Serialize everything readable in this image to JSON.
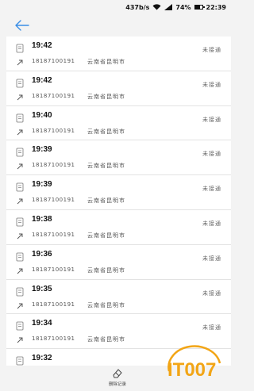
{
  "status_bar": {
    "speed": "437b/s",
    "battery_text": "74%",
    "battery_level": 0.74,
    "time": "22:39"
  },
  "header": {
    "back_icon": "back-arrow-icon"
  },
  "records": [
    {
      "time": "19:42",
      "phone": "18187100191",
      "location": "云南省昆明市",
      "status": "未接通"
    },
    {
      "time": "19:42",
      "phone": "18187100191",
      "location": "云南省昆明市",
      "status": "未接通"
    },
    {
      "time": "19:40",
      "phone": "18187100191",
      "location": "云南省昆明市",
      "status": "未接通"
    },
    {
      "time": "19:39",
      "phone": "18187100191",
      "location": "云南省昆明市",
      "status": "未接通"
    },
    {
      "time": "19:39",
      "phone": "18187100191",
      "location": "云南省昆明市",
      "status": "未接通"
    },
    {
      "time": "19:38",
      "phone": "18187100191",
      "location": "云南省昆明市",
      "status": "未接通"
    },
    {
      "time": "19:36",
      "phone": "18187100191",
      "location": "云南省昆明市",
      "status": "未接通"
    },
    {
      "time": "19:35",
      "phone": "18187100191",
      "location": "云南省昆明市",
      "status": "未接通"
    },
    {
      "time": "19:34",
      "phone": "18187100191",
      "location": "云南省昆明市",
      "status": "未接通"
    },
    {
      "time": "19:32",
      "phone": "",
      "location": "",
      "status": ""
    }
  ],
  "footer": {
    "delete_label": "删除记录"
  },
  "watermark": {
    "text": "IT007"
  },
  "colors": {
    "accent": "#3a8ee6",
    "watermark": "#f2a516"
  }
}
